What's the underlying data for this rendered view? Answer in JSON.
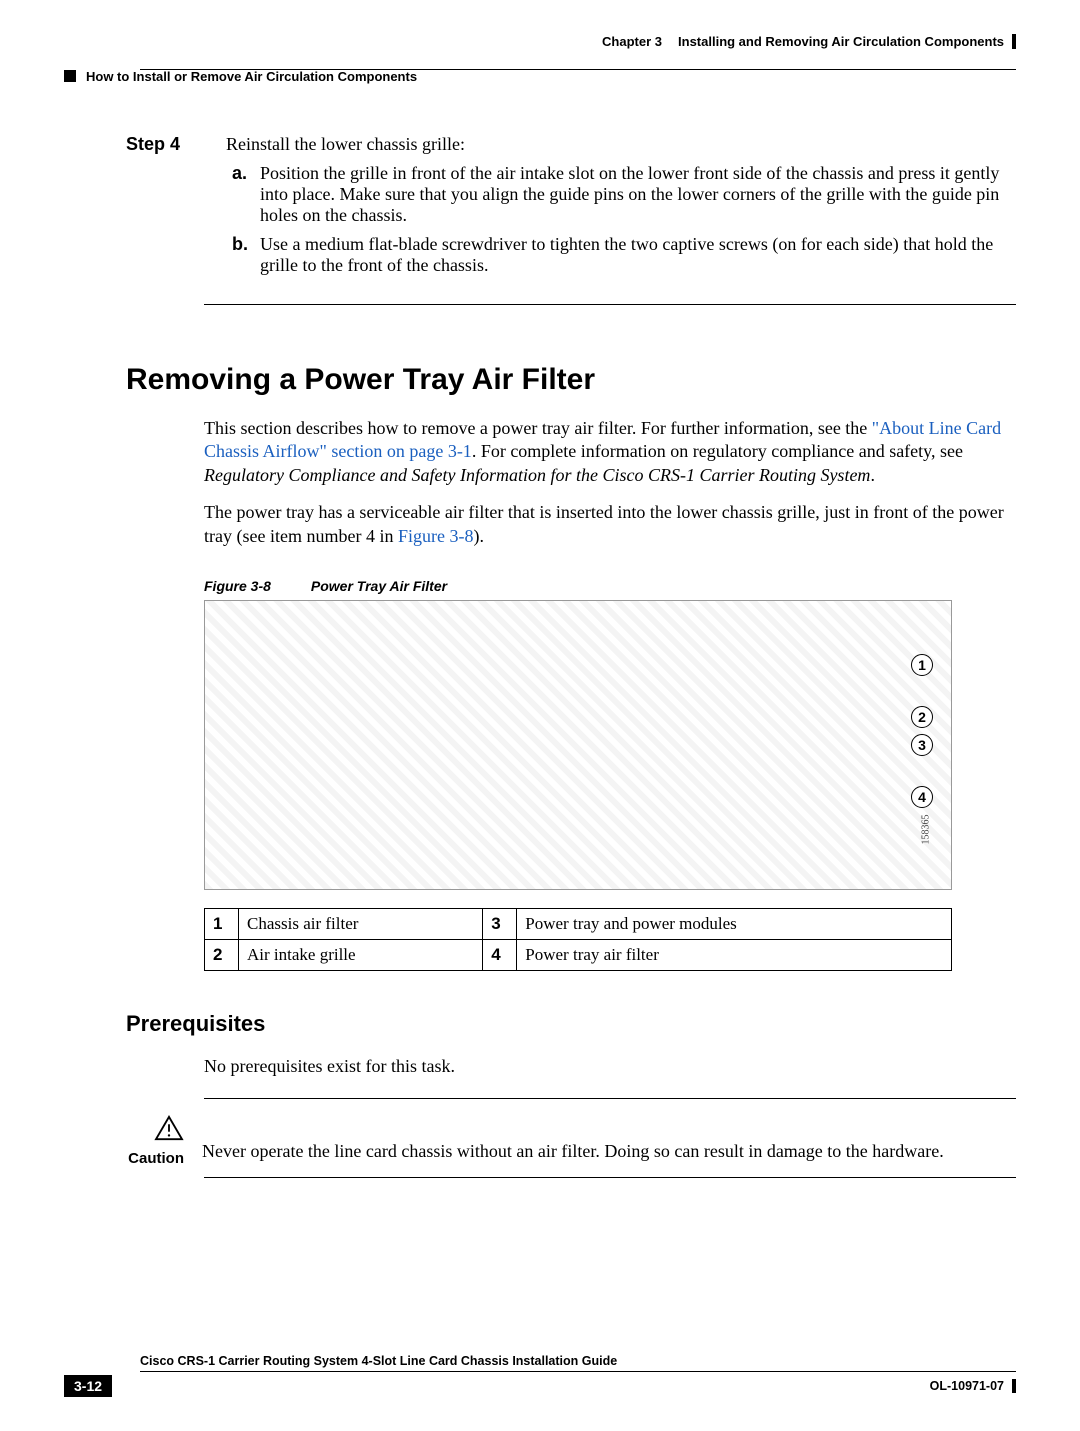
{
  "header": {
    "chapter_label": "Chapter 3",
    "chapter_title": "Installing and Removing Air Circulation Components",
    "section_title": "How to Install or Remove Air Circulation Components"
  },
  "step": {
    "label": "Step 4",
    "text": "Reinstall the lower chassis grille:",
    "a_label": "a.",
    "a_text": "Position the grille in front of the air intake slot on the lower front side of the chassis and press it gently into place. Make sure that you align the guide pins on the lower corners of the grille with the guide pin holes on the chassis.",
    "b_label": "b.",
    "b_text": "Use a medium flat-blade screwdriver to tighten the two captive screws (on for each side) that hold the grille to the front of the chassis."
  },
  "section": {
    "heading": "Removing a Power Tray Air Filter",
    "para1_a": "This section describes how to remove a power tray air filter. For further information, see the ",
    "para1_link": "\"About Line Card Chassis Airflow\" section on page 3-1",
    "para1_b": ". For complete information on regulatory compliance and safety, see ",
    "para1_italic": "Regulatory Compliance and Safety Information for the Cisco CRS-1 Carrier Routing System",
    "para1_c": ".",
    "para2_a": "The power tray has a serviceable air filter that is inserted into the lower chassis grille, just in front of the power tray (see item number 4 in ",
    "para2_link": "Figure 3-8",
    "para2_b": ")."
  },
  "figure": {
    "label": "Figure 3-8",
    "title": "Power Tray Air Filter",
    "filenum": "158365",
    "callouts": [
      "1",
      "2",
      "3",
      "4"
    ]
  },
  "legend": [
    {
      "n": "1",
      "t": "Chassis air filter",
      "n2": "3",
      "t2": "Power tray and power modules"
    },
    {
      "n": "2",
      "t": "Air intake grille",
      "n2": "4",
      "t2": "Power tray air filter"
    }
  ],
  "prereq": {
    "heading": "Prerequisites",
    "text": "No prerequisites exist for this task.",
    "caution_label": "Caution",
    "caution_text": "Never operate the line card chassis without an air filter. Doing so can result in damage to the hardware."
  },
  "footer": {
    "guide": "Cisco CRS-1 Carrier Routing System 4-Slot Line Card Chassis Installation Guide",
    "page": "3-12",
    "docnum": "OL-10971-07"
  }
}
